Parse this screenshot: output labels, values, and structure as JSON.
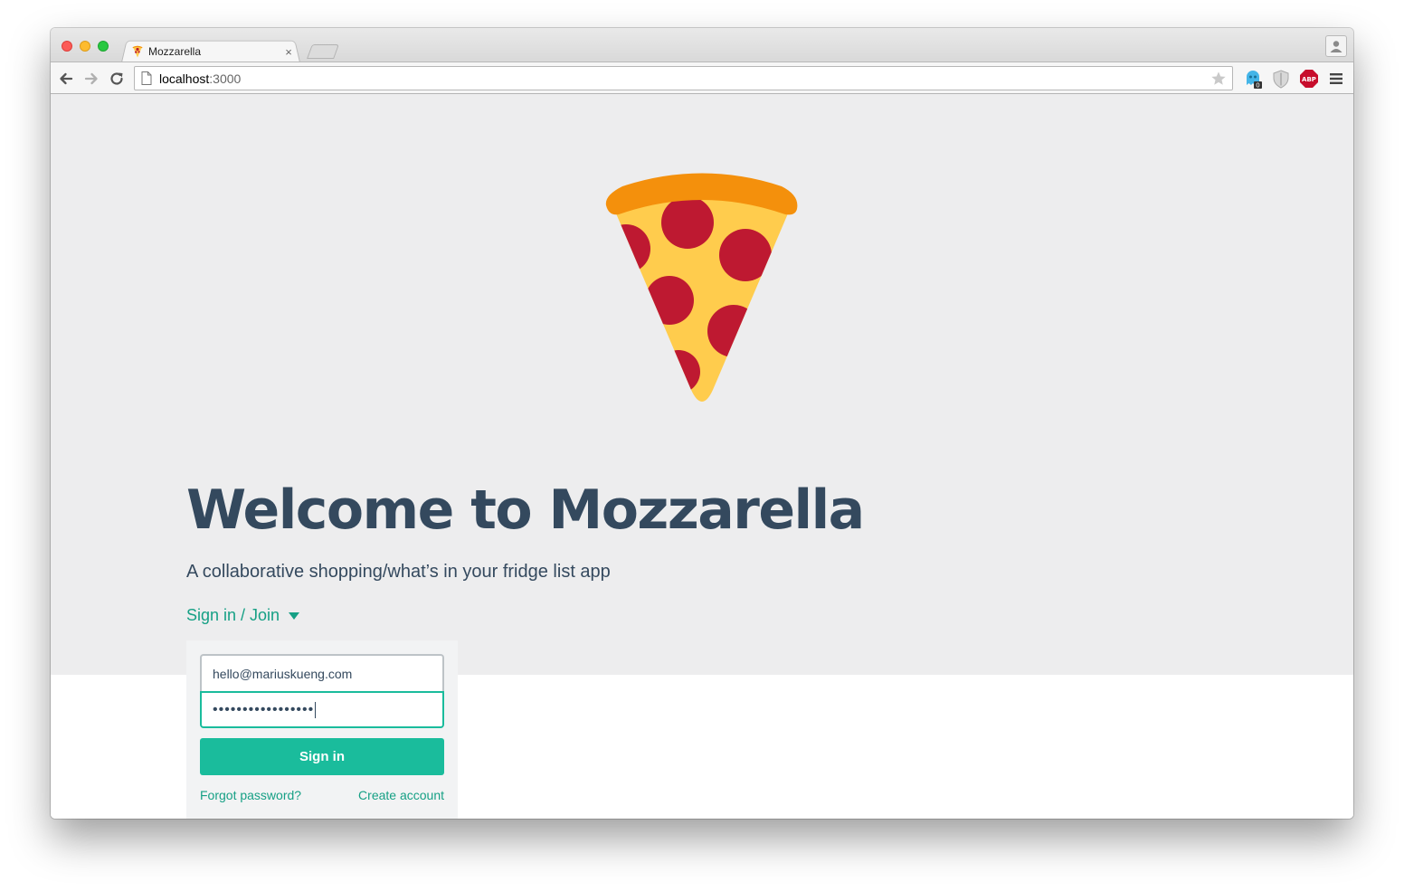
{
  "browser": {
    "tab_title": "Mozzarella",
    "tab_close": "×",
    "url_host": "localhost",
    "url_port": ":3000",
    "extensions": [
      "ghostery-icon",
      "privacy-shield-icon",
      "adblock-plus-icon"
    ],
    "ghostery_badge": "0",
    "abp_label": "ABP"
  },
  "page": {
    "title": "Welcome to Mozzarella",
    "subtitle": "A collaborative shopping/what’s in your fridge list app",
    "toggle_label": "Sign in / Join"
  },
  "login": {
    "email_value": "hello@mariuskueng.com",
    "password_masked": "•••••••••••••••••",
    "signin_label": "Sign in",
    "forgot_label": "Forgot password?",
    "create_label": "Create account"
  },
  "colors": {
    "accent": "#1abc9c",
    "link": "#16a085",
    "heading": "#34495e",
    "hero_bg": "#ededee",
    "pizza_crust": "#f4900c",
    "pizza_cheese": "#ffcc4d",
    "pepperoni": "#be1931"
  }
}
